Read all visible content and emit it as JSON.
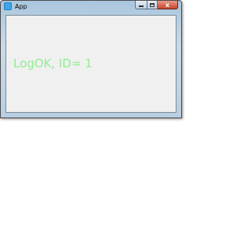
{
  "window": {
    "title": "App",
    "icon": "app-icon",
    "caption_buttons": {
      "minimize_icon": "minimize-icon",
      "maximize_icon": "maximize-icon",
      "close_label": "x"
    }
  },
  "content": {
    "label_text": "LogOK, ID= 1",
    "label_color": "#90ee90",
    "background_color": "#f0f0f0"
  }
}
